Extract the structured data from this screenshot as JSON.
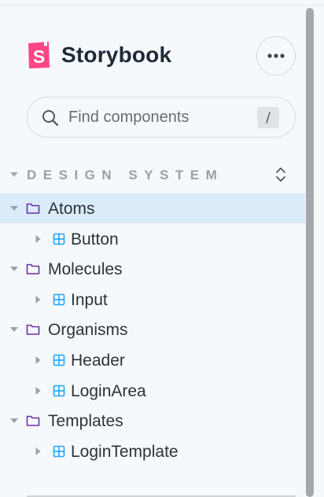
{
  "header": {
    "brand": "Storybook",
    "menu_icon": "ellipsis-icon",
    "logo_color": "#ff4785"
  },
  "search": {
    "placeholder": "Find components",
    "shortcut": "/"
  },
  "section": {
    "title": "DESIGN SYSTEM",
    "expanded": true
  },
  "tree": [
    {
      "label": "Atoms",
      "type": "folder",
      "depth": 0,
      "expanded": true,
      "selected": true
    },
    {
      "label": "Button",
      "type": "component",
      "depth": 1,
      "expanded": false,
      "selected": false
    },
    {
      "label": "Molecules",
      "type": "folder",
      "depth": 0,
      "expanded": true,
      "selected": false
    },
    {
      "label": "Input",
      "type": "component",
      "depth": 1,
      "expanded": false,
      "selected": false
    },
    {
      "label": "Organisms",
      "type": "folder",
      "depth": 0,
      "expanded": true,
      "selected": false
    },
    {
      "label": "Header",
      "type": "component",
      "depth": 1,
      "expanded": false,
      "selected": false
    },
    {
      "label": "LoginArea",
      "type": "component",
      "depth": 1,
      "expanded": false,
      "selected": false
    },
    {
      "label": "Templates",
      "type": "folder",
      "depth": 0,
      "expanded": true,
      "selected": false
    },
    {
      "label": "LoginTemplate",
      "type": "component",
      "depth": 1,
      "expanded": false,
      "selected": false
    }
  ],
  "colors": {
    "background": "#f6f9fc",
    "selected_row": "#dcebf9",
    "folder_icon": "#6f2cac",
    "component_icon": "#1ea7fd",
    "section_title": "#97a0a8"
  }
}
